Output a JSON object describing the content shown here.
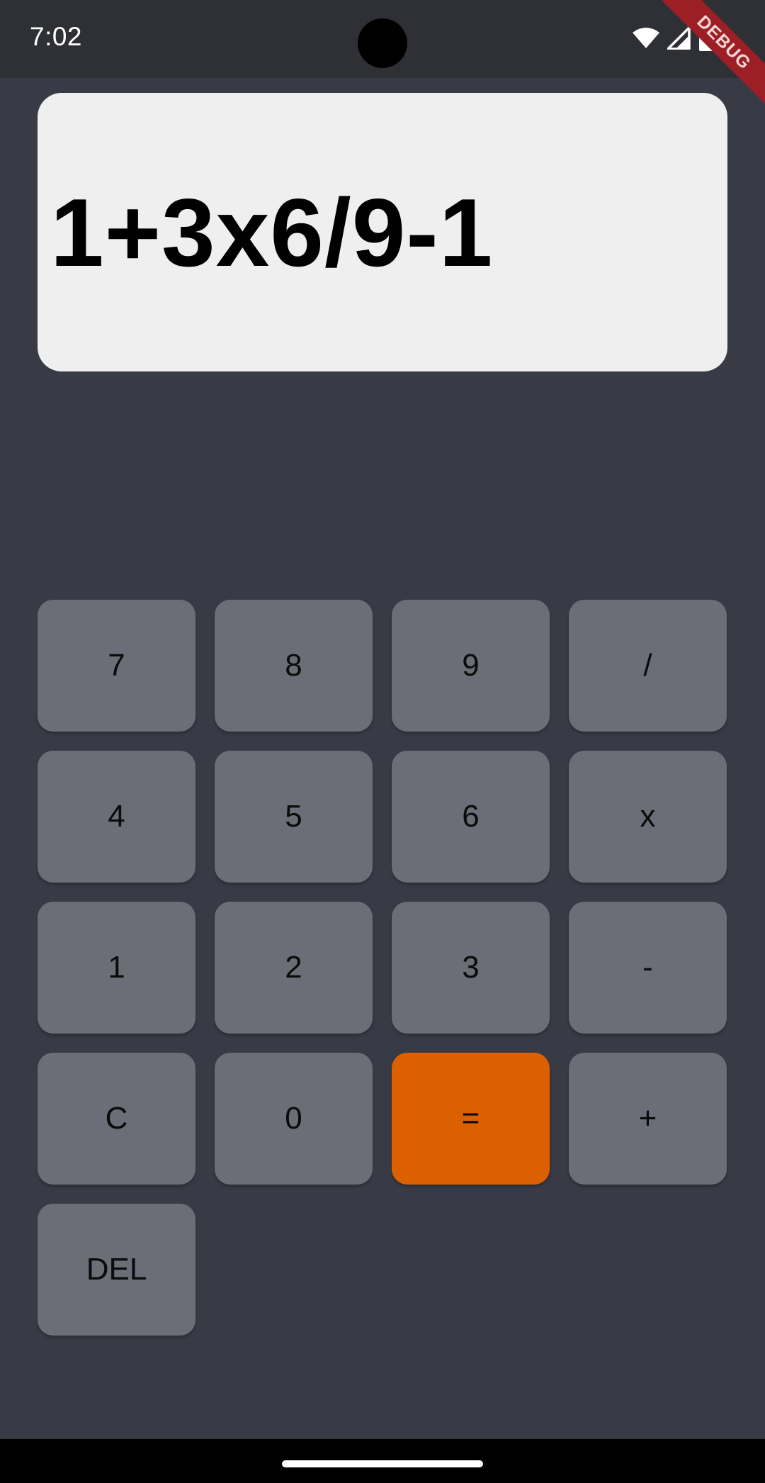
{
  "status_bar": {
    "time": "7:02",
    "icons": [
      "wifi-icon",
      "cellular-signal-icon",
      "battery-icon"
    ]
  },
  "debug_banner": "DEBUG",
  "display": {
    "expression": "1+3x6/9-1"
  },
  "keypad": {
    "rows": [
      [
        "7",
        "8",
        "9",
        "/"
      ],
      [
        "4",
        "5",
        "6",
        "x"
      ],
      [
        "1",
        "2",
        "3",
        "-"
      ],
      [
        "C",
        "0",
        "=",
        "+"
      ],
      [
        "DEL"
      ]
    ]
  },
  "colors": {
    "background": "#383b45",
    "display_background": "#efefef",
    "key_background": "#6b6e77",
    "equals_key_background": "#dc6000",
    "debug_ribbon": "#9c1f26"
  }
}
